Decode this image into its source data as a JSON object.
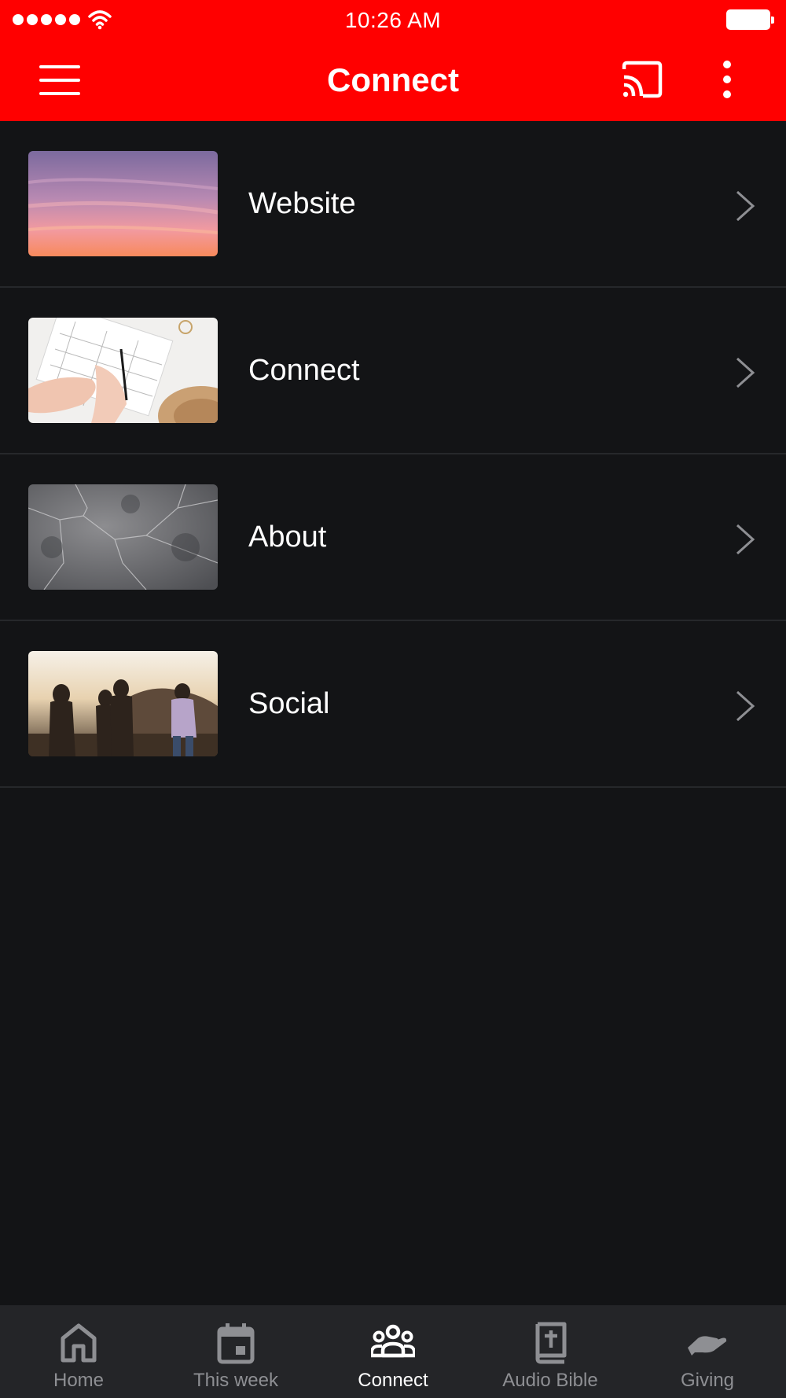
{
  "status": {
    "time": "10:26 AM",
    "signal_icon": "cellular-signal-icon",
    "wifi_icon": "wifi-icon",
    "battery_icon": "battery-icon"
  },
  "header": {
    "title": "Connect",
    "background_color": "#ff0000",
    "menu_icon": "hamburger-menu-icon",
    "cast_icon": "cast-icon",
    "more_icon": "more-vertical-icon"
  },
  "list": {
    "items": [
      {
        "label": "Website",
        "thumbnail": "sunset-sky-thumbnail",
        "chevron_icon": "chevron-right-icon"
      },
      {
        "label": "Connect",
        "thumbnail": "planner-writing-thumbnail",
        "chevron_icon": "chevron-right-icon"
      },
      {
        "label": "About",
        "thumbnail": "marble-texture-thumbnail",
        "chevron_icon": "chevron-right-icon"
      },
      {
        "label": "Social",
        "thumbnail": "friends-sunset-thumbnail",
        "chevron_icon": "chevron-right-icon"
      }
    ]
  },
  "tabs": {
    "items": [
      {
        "label": "Home",
        "icon": "home-icon",
        "active": false
      },
      {
        "label": "This week",
        "icon": "calendar-icon",
        "active": false
      },
      {
        "label": "Connect",
        "icon": "people-group-icon",
        "active": true
      },
      {
        "label": "Audio Bible",
        "icon": "bible-icon",
        "active": false
      },
      {
        "label": "Giving",
        "icon": "giving-hand-icon",
        "active": false
      }
    ],
    "active_color": "#ffffff",
    "inactive_color": "#8e8f93"
  },
  "colors": {
    "background": "#131416",
    "divider": "#26282b",
    "tab_bar": "#242528"
  }
}
